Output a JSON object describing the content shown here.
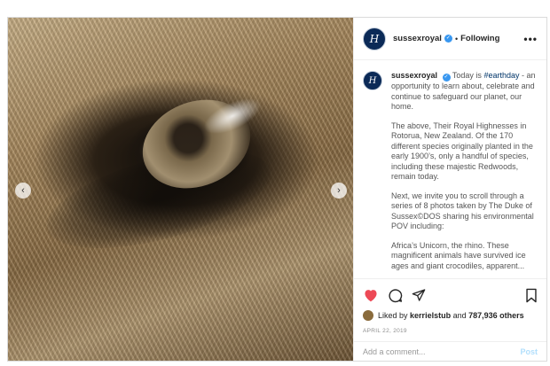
{
  "post": {
    "username": "sussexroyal",
    "avatar_letter": "H",
    "follow_status": "Following",
    "more_label": "•••",
    "separator": "•"
  },
  "caption": {
    "intro_text": "Today is",
    "hashtag": "#earthday",
    "intro_rest": "- an opportunity to learn about, celebrate and continue to safeguard our planet, our home.",
    "paragraph_2": "The above, Their Royal Highnesses in Rotorua, New Zealand. Of the 170 different species originally planted in the early 1900’s, only a handful of species, including these majestic Redwoods, remain today.",
    "paragraph_3": "Next, we invite you to scroll through a series of 8 photos taken by The Duke of Sussex©DOS sharing his environmental POV including:",
    "paragraph_4": "Africa’s Unicorn, the rhino. These magnificent animals have survived ice ages and giant crocodiles, apparent..."
  },
  "engagement": {
    "liked_by_prefix": "Liked by",
    "liked_by_user": "kerrielstub",
    "and_label": "and",
    "others_count": "787,936 others",
    "date": "APRIL 22, 2019"
  },
  "comment_box": {
    "placeholder": "Add a comment...",
    "post_label": "Post"
  },
  "colors": {
    "heart": "#ed4956",
    "verified": "#3897f0",
    "avatar_bg": "#0b2a57"
  },
  "icons": [
    "heart-icon",
    "comment-icon",
    "share-icon",
    "bookmark-icon",
    "chevron-left-icon",
    "chevron-right-icon",
    "verified-icon"
  ]
}
